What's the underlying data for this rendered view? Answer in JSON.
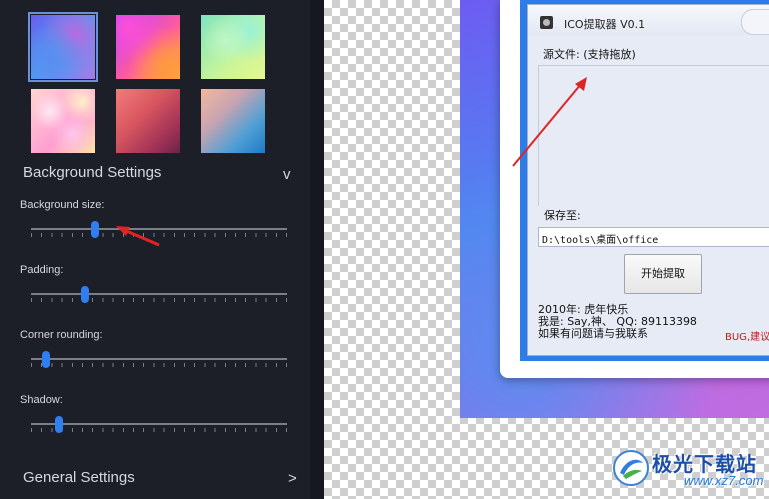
{
  "sidebar": {
    "thumbnails": [
      {
        "name": "blue-purple-gradient",
        "selected": true
      },
      {
        "name": "pink-orange-gradient",
        "selected": false
      },
      {
        "name": "mint-green-bokeh",
        "selected": false
      },
      {
        "name": "pastel-pink-bokeh",
        "selected": false
      },
      {
        "name": "red-lowpoly",
        "selected": false
      },
      {
        "name": "peach-blue-lowpoly",
        "selected": false
      }
    ],
    "background_settings": {
      "title": "Background Settings",
      "chevron": "v",
      "sliders": [
        {
          "label": "Background size:",
          "value": 0.25
        },
        {
          "label": "Padding:",
          "value": 0.21
        },
        {
          "label": "Corner rounding:",
          "value": 0.06
        },
        {
          "label": "Shadow:",
          "value": 0.11
        }
      ]
    },
    "general_settings": {
      "title": "General Settings",
      "chevron": ">"
    }
  },
  "app_window": {
    "title": "ICO提取器 V0.1",
    "source_label": "源文件: (支持拖放)",
    "save_label": "保存至:",
    "save_path": "D:\\tools\\桌面\\office",
    "extract_button": "开始提取",
    "info_lines": [
      "2010年: 虎年快乐",
      "我是: Say,神、 QQ: 89113398",
      "如果有问题请与我联系"
    ],
    "bug_note": "BUG,建议"
  },
  "watermark": {
    "title": "极光下载站",
    "url": "www.xz7.com"
  },
  "colors": {
    "panel_bg": "#1c1f28",
    "slider_knob": "#2f7ff0",
    "annotation_arrow": "#e02424"
  },
  "icons": {
    "app_icon": "gear-icon",
    "close_icon": "close-icon",
    "watermark_logo": "aurora-logo-icon"
  }
}
